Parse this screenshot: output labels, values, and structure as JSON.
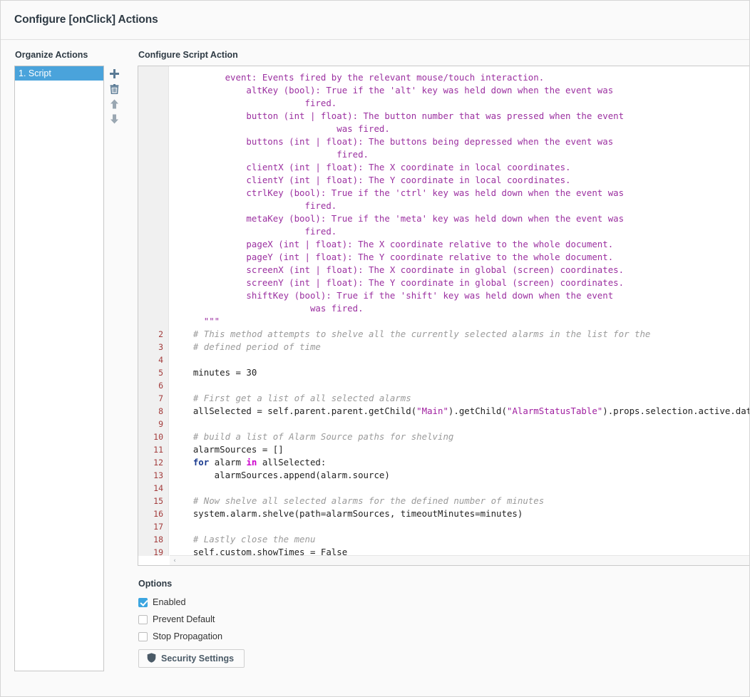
{
  "window": {
    "title": "Configure [onClick] Actions"
  },
  "organize": {
    "label": "Organize Actions",
    "items": [
      {
        "label": "1. Script",
        "selected": true
      }
    ],
    "toolbar": [
      {
        "name": "add-action-button",
        "icon": "plus-icon",
        "tooltip": "Add"
      },
      {
        "name": "delete-action-button",
        "icon": "trash-icon",
        "tooltip": "Delete"
      },
      {
        "name": "move-up-button",
        "icon": "arrow-up-icon",
        "tooltip": "Move Up"
      },
      {
        "name": "move-down-button",
        "icon": "arrow-down-icon",
        "tooltip": "Move Down"
      }
    ]
  },
  "configure": {
    "label": "Configure Script Action",
    "scrollbar": {
      "left_arrow": "‹"
    },
    "editor": {
      "lines": [
        {
          "num": "",
          "spans": [
            {
              "t": "doc",
              "s": "          event: Events fired by the relevant mouse/touch interaction."
            }
          ]
        },
        {
          "num": "",
          "spans": [
            {
              "t": "doc",
              "s": "              altKey (bool): True if the 'alt' key was held down when the event was"
            }
          ]
        },
        {
          "num": "",
          "spans": [
            {
              "t": "doc",
              "s": "                         fired."
            }
          ]
        },
        {
          "num": "",
          "spans": [
            {
              "t": "doc",
              "s": "              button (int | float): The button number that was pressed when the event"
            }
          ]
        },
        {
          "num": "",
          "spans": [
            {
              "t": "doc",
              "s": "                               was fired."
            }
          ]
        },
        {
          "num": "",
          "spans": [
            {
              "t": "doc",
              "s": "              buttons (int | float): The buttons being depressed when the event was"
            }
          ]
        },
        {
          "num": "",
          "spans": [
            {
              "t": "doc",
              "s": "                               fired."
            }
          ]
        },
        {
          "num": "",
          "spans": [
            {
              "t": "doc",
              "s": "              clientX (int | float): The X coordinate in local coordinates."
            }
          ]
        },
        {
          "num": "",
          "spans": [
            {
              "t": "doc",
              "s": "              clientY (int | float): The Y coordinate in local coordinates."
            }
          ]
        },
        {
          "num": "",
          "spans": [
            {
              "t": "doc",
              "s": "              ctrlKey (bool): True if the 'ctrl' key was held down when the event was"
            }
          ]
        },
        {
          "num": "",
          "spans": [
            {
              "t": "doc",
              "s": "                         fired."
            }
          ]
        },
        {
          "num": "",
          "spans": [
            {
              "t": "doc",
              "s": "              metaKey (bool): True if the 'meta' key was held down when the event was"
            }
          ]
        },
        {
          "num": "",
          "spans": [
            {
              "t": "doc",
              "s": "                         fired."
            }
          ]
        },
        {
          "num": "",
          "spans": [
            {
              "t": "doc",
              "s": "              pageX (int | float): The X coordinate relative to the whole document."
            }
          ]
        },
        {
          "num": "",
          "spans": [
            {
              "t": "doc",
              "s": "              pageY (int | float): The Y coordinate relative to the whole document."
            }
          ]
        },
        {
          "num": "",
          "spans": [
            {
              "t": "doc",
              "s": "              screenX (int | float): The X coordinate in global (screen) coordinates."
            }
          ]
        },
        {
          "num": "",
          "spans": [
            {
              "t": "doc",
              "s": "              screenY (int | float): The Y coordinate in global (screen) coordinates."
            }
          ]
        },
        {
          "num": "",
          "spans": [
            {
              "t": "doc",
              "s": "              shiftKey (bool): True if the 'shift' key was held down when the event"
            }
          ]
        },
        {
          "num": "",
          "spans": [
            {
              "t": "doc",
              "s": "                          was fired."
            }
          ]
        },
        {
          "num": "",
          "spans": [
            {
              "t": "doc",
              "s": "      \"\"\""
            }
          ]
        },
        {
          "num": "2",
          "spans": [
            {
              "t": "cmt",
              "s": "    # This method attempts to shelve all the currently selected alarms in the list for the"
            }
          ]
        },
        {
          "num": "3",
          "spans": [
            {
              "t": "cmt",
              "s": "    # defined period of time"
            }
          ]
        },
        {
          "num": "4",
          "spans": [
            {
              "t": "plain",
              "s": ""
            }
          ]
        },
        {
          "num": "5",
          "spans": [
            {
              "t": "plain",
              "s": "    minutes = 30"
            }
          ]
        },
        {
          "num": "6",
          "spans": [
            {
              "t": "plain",
              "s": ""
            }
          ]
        },
        {
          "num": "7",
          "spans": [
            {
              "t": "cmt",
              "s": "    # First get a list of all selected alarms"
            }
          ]
        },
        {
          "num": "8",
          "spans": [
            {
              "t": "plain",
              "s": "    allSelected = self.parent.parent.getChild("
            },
            {
              "t": "str",
              "s": "\"Main\""
            },
            {
              "t": "plain",
              "s": ").getChild("
            },
            {
              "t": "str",
              "s": "\"AlarmStatusTable\""
            },
            {
              "t": "plain",
              "s": ").props.selection.active.data"
            }
          ]
        },
        {
          "num": "9",
          "spans": [
            {
              "t": "plain",
              "s": ""
            }
          ]
        },
        {
          "num": "10",
          "spans": [
            {
              "t": "cmt",
              "s": "    # build a list of Alarm Source paths for shelving"
            }
          ]
        },
        {
          "num": "11",
          "spans": [
            {
              "t": "plain",
              "s": "    alarmSources = []"
            }
          ]
        },
        {
          "num": "12",
          "spans": [
            {
              "t": "plain",
              "s": "    "
            },
            {
              "t": "kw",
              "s": "for"
            },
            {
              "t": "plain",
              "s": " alarm "
            },
            {
              "t": "op",
              "s": "in"
            },
            {
              "t": "plain",
              "s": " allSelected:"
            }
          ]
        },
        {
          "num": "13",
          "spans": [
            {
              "t": "plain",
              "s": "        alarmSources.append(alarm.source)"
            }
          ]
        },
        {
          "num": "14",
          "spans": [
            {
              "t": "plain",
              "s": ""
            }
          ]
        },
        {
          "num": "15",
          "spans": [
            {
              "t": "cmt",
              "s": "    # Now shelve all selected alarms for the defined number of minutes"
            }
          ]
        },
        {
          "num": "16",
          "spans": [
            {
              "t": "plain",
              "s": "    system.alarm.shelve(path=alarmSources, timeoutMinutes=minutes)"
            }
          ]
        },
        {
          "num": "17",
          "spans": [
            {
              "t": "plain",
              "s": ""
            }
          ]
        },
        {
          "num": "18",
          "spans": [
            {
              "t": "cmt",
              "s": "    # Lastly close the menu"
            }
          ]
        },
        {
          "num": "19",
          "spans": [
            {
              "t": "plain",
              "s": "    self.custom.showTimes = False"
            }
          ]
        }
      ]
    }
  },
  "options": {
    "label": "Options",
    "checkboxes": [
      {
        "label": "Enabled",
        "checked": true
      },
      {
        "label": "Prevent Default",
        "checked": false
      },
      {
        "label": "Stop Propagation",
        "checked": false
      }
    ],
    "security_button": {
      "label": "Security Settings",
      "icon": "shield-icon"
    }
  },
  "colors": {
    "accent": "#4aa3db",
    "checkbox_checked": "#3ca5e0",
    "title_text": "#2e3a44",
    "docstring": "#9b30a0",
    "string": "#a020a0",
    "comment": "#9a9a9a",
    "keyword": "#1a3a8f",
    "operator": "#cc00cc",
    "line_number": "#a33c3c",
    "gutter_bg": "#f0f0f0",
    "panel_bg": "#fafafa"
  }
}
